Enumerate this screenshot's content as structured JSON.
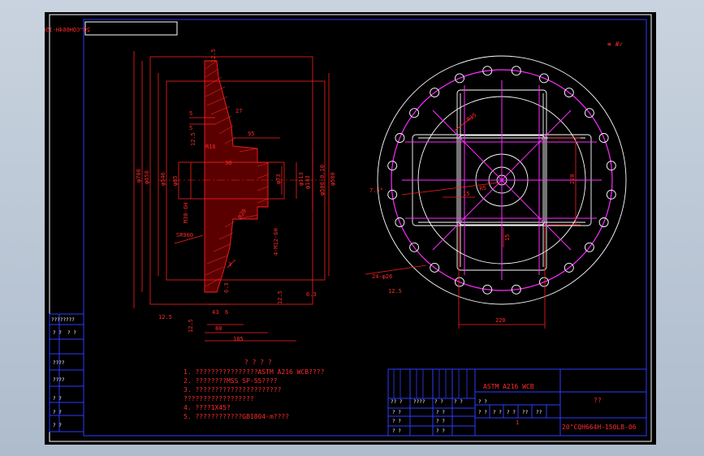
{
  "drawing": {
    "drawing_number_mirrored": "20\"CQH664H-150LB-06",
    "corner_marks": "≡ #✓",
    "section_view": {
      "roughness_top": "12.5",
      "dims_vertical_left": [
        "φ700",
        "φ650",
        "φ546",
        "φ85"
      ],
      "dims_vertical_right": [
        "φ580",
        "φ500-0.10",
        "φ143",
        "φ113",
        "φ73"
      ],
      "dim_5a": "5",
      "dim_5b": "5",
      "dim_27": "27",
      "dim_95": "95",
      "dim_30": "30",
      "dim_ra16": "R16",
      "dim_ra20": "R20",
      "dim_r900": "SR900",
      "dim_m30": "M30-6H",
      "dim_m12": "4-M12-6H",
      "dim_43": "43",
      "dim_6": "6",
      "dim_80": "80",
      "dim_185": "185",
      "dim_3": "3",
      "rough_values": [
        "12.5",
        "12.5",
        "6.3",
        "12.5",
        "6.3",
        "12.5"
      ]
    },
    "plan_view": {
      "dim_r15": "R15",
      "dim_r5": "R5",
      "dim_15a": "15",
      "dim_15b": "15",
      "dim_7_5": "7.5°",
      "dim_220v": "220",
      "dim_220h": "220",
      "holes_label": "24-φ26",
      "rough": "12.5"
    },
    "notes": {
      "heading": "? ? ? ?",
      "lines": [
        "1. ????????????????ASTM A216 WCB????",
        "2. ????????MSS SP-55????",
        "3. ??????????????????????",
        "   ??????????????????",
        "4. ????1X45?",
        "5. ????????????GB1804-m????"
      ]
    },
    "left_table": {
      "header": "????????",
      "rows": [
        "? ?",
        "? ?",
        "????",
        "????",
        "? ?",
        "? ?",
        "? ?"
      ]
    },
    "title_block": {
      "material": "ASTM A216 WCB",
      "part_name": "??",
      "drawing_no": "20\"CQH664H-150LB-06",
      "rev_cells": [
        "?? ?",
        "????",
        "? ?",
        "? ?",
        "? ?"
      ],
      "sign_cells": [
        "? ?",
        "? ?",
        "? ?",
        "? ?",
        "? ?",
        "? ?"
      ],
      "weight_cells": [
        "? ?",
        "? ?",
        "? ?",
        "??",
        "??"
      ],
      "scale": "1"
    }
  }
}
